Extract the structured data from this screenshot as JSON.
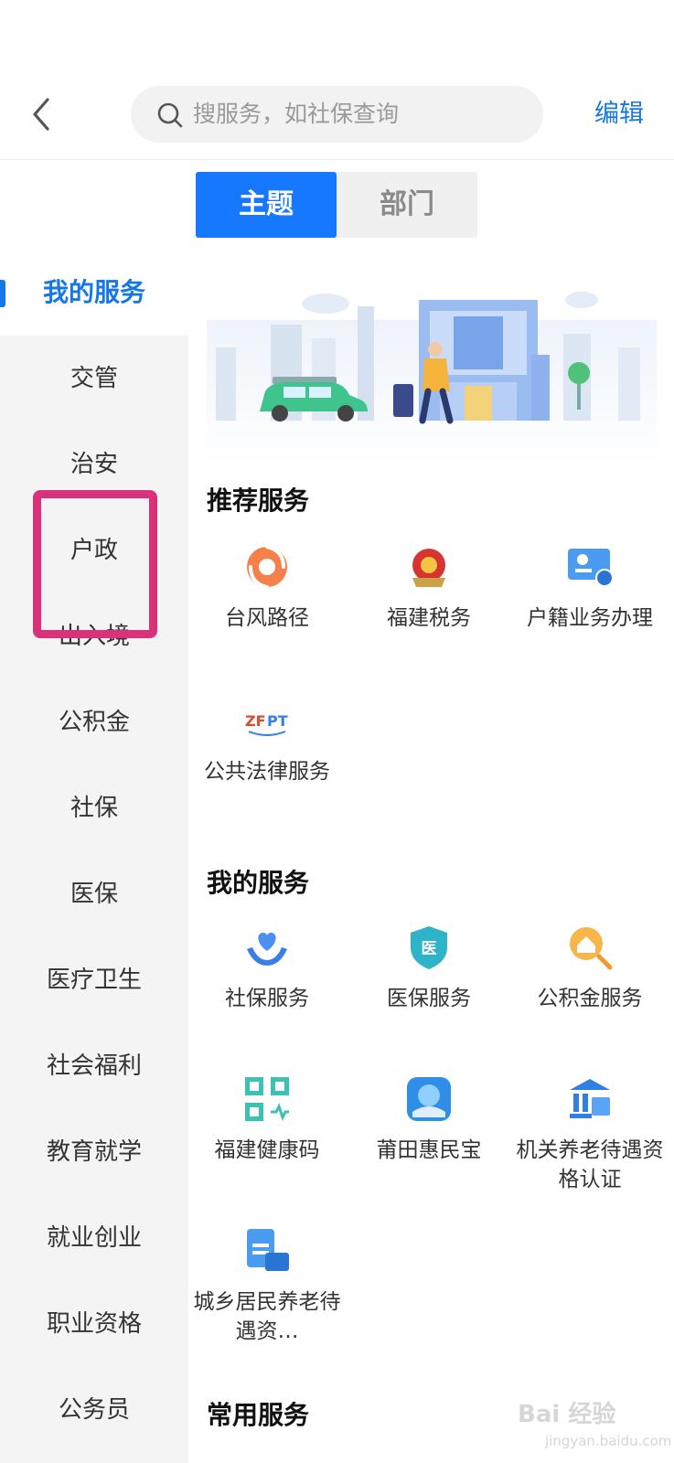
{
  "header": {
    "search_placeholder": "搜服务，如社保查询",
    "edit_label": "编辑"
  },
  "tabs": [
    {
      "label": "主题",
      "active": true
    },
    {
      "label": "部门",
      "active": false
    }
  ],
  "sidebar": {
    "items": [
      {
        "label": "我的服务",
        "active": true
      },
      {
        "label": "交管"
      },
      {
        "label": "治安"
      },
      {
        "label": "户政"
      },
      {
        "label": "出入境"
      },
      {
        "label": "公积金"
      },
      {
        "label": "社保"
      },
      {
        "label": "医保"
      },
      {
        "label": "医疗卫生"
      },
      {
        "label": "社会福利"
      },
      {
        "label": "教育就学"
      },
      {
        "label": "就业创业"
      },
      {
        "label": "职业资格"
      },
      {
        "label": "公务员"
      }
    ]
  },
  "sections": {
    "recommended": {
      "title": "推荐服务",
      "items": [
        {
          "label": "台风路径",
          "icon": "typhoon-icon"
        },
        {
          "label": "福建税务",
          "icon": "tax-emblem-icon"
        },
        {
          "label": "户籍业务办理",
          "icon": "id-card-icon"
        },
        {
          "label": "公共法律服务",
          "icon": "zfpt-logo-icon"
        }
      ]
    },
    "mine": {
      "title": "我的服务",
      "items": [
        {
          "label": "社保服务",
          "icon": "hands-heart-icon"
        },
        {
          "label": "医保服务",
          "icon": "medical-shield-icon"
        },
        {
          "label": "公积金服务",
          "icon": "house-fund-icon"
        },
        {
          "label": "福建健康码",
          "icon": "qr-code-icon"
        },
        {
          "label": "莆田惠民宝",
          "icon": "huimin-app-icon"
        },
        {
          "label": "机关养老待遇资格认证",
          "icon": "bank-building-icon"
        },
        {
          "label": "城乡居民养老待遇资…",
          "icon": "pension-card-icon"
        }
      ]
    },
    "common": {
      "title": "常用服务"
    }
  },
  "watermark": {
    "text": "Bai 经验",
    "sub": "jingyan.baidu.com"
  },
  "colors": {
    "accent": "#1677ff",
    "highlight": "#d9317a"
  }
}
